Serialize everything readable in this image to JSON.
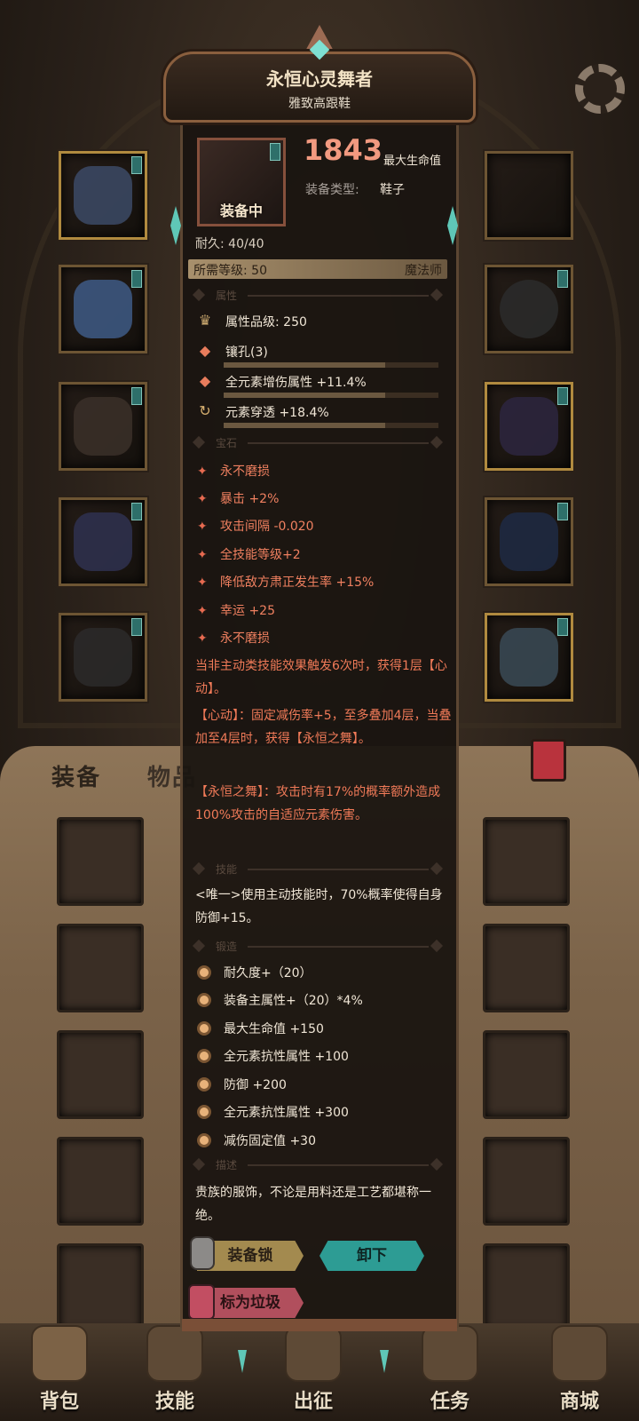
{
  "colors": {
    "accent_red": "#f29a80",
    "gem_text": "#f08060",
    "teal": "#2d9c94"
  },
  "tabs": {
    "equipment": "装备",
    "items": "物品"
  },
  "nav": [
    {
      "label": "背包",
      "icon": "bag-icon"
    },
    {
      "label": "技能",
      "icon": "skill-icon"
    },
    {
      "label": "出征",
      "icon": "battle-icon"
    },
    {
      "label": "任务",
      "icon": "quest-icon"
    },
    {
      "label": "商城",
      "icon": "shop-icon"
    }
  ],
  "item": {
    "name": "永恒心灵舞者",
    "subtitle": "雅致高跟鞋",
    "equipped_label": "装备中",
    "stat_value": "1843",
    "stat_label": "最大生命值",
    "type_label": "装备类型:",
    "type_value": "鞋子",
    "durability_label": "耐久:",
    "durability_value": "40/40",
    "level_label": "所需等级: 50",
    "class": "魔法师"
  },
  "sections": {
    "attributes": "属性",
    "gems": "宝石",
    "skills": "技能",
    "forge": "锻造",
    "desc": "描述"
  },
  "attributes": [
    {
      "icon": "grade-icon",
      "text": "属性品级: 250"
    },
    {
      "icon": "socket-icon",
      "text": "镶孔(3)"
    },
    {
      "icon": "element-dmg-icon",
      "text": "全元素增伤属性 +11.4%"
    },
    {
      "icon": "penetration-icon",
      "text": "元素穿透 +18.4%"
    }
  ],
  "gems": [
    "永不磨损",
    "暴击 +2%",
    "攻击间隔 -0.020",
    "全技能等级+2",
    "降低敌方肃正发生率 +15%",
    "幸运 +25",
    "永不磨损"
  ],
  "effects": [
    "当非主动类技能效果触发6次时，获得1层【心动】。",
    "【心动】：固定减伤率+5，至多叠加4层，当叠加至4层时，获得【永恒之舞】。",
    "【永恒之舞】：攻击时有17%的概率额外造成100%攻击的自适应元素伤害。"
  ],
  "skill_text": "<唯一>使用主动技能时，70%概率使得自身防御+15。",
  "forge": [
    "耐久度+（20）",
    "装备主属性+（20）*4%",
    "最大生命值 +150",
    "全元素抗性属性 +100",
    "防御 +200",
    "全元素抗性属性 +300",
    "减伤固定值 +30"
  ],
  "description": "贵族的服饰，不论是用料还是工艺都堪称一绝。",
  "buttons": {
    "lock": "装备锁",
    "unequip": "卸下",
    "junk": "标为垃圾"
  }
}
